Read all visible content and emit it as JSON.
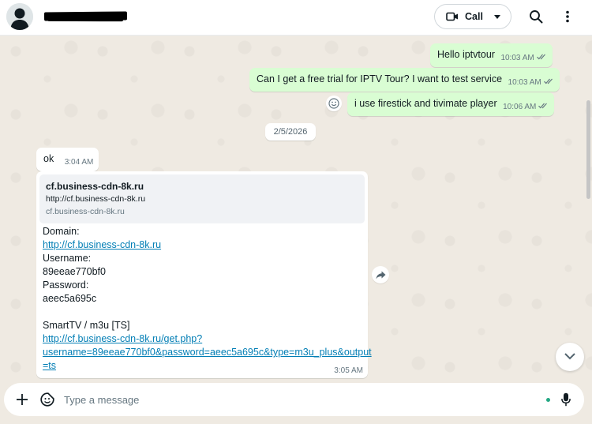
{
  "header": {
    "call_label": "Call"
  },
  "messages": [
    {
      "text": "Hello iptvtour",
      "time": "10:03 AM",
      "dir": "out"
    },
    {
      "text": "Can I get a free trial for IPTV Tour? I want to test service",
      "time": "10:03 AM",
      "dir": "out"
    },
    {
      "text": "i use firestick and tivimate player",
      "time": "10:06 AM",
      "dir": "out"
    }
  ],
  "date_separator": "2/5/2026",
  "incoming_ok": {
    "text": "ok",
    "time": "3:04 AM"
  },
  "incoming_details": {
    "preview_title": "cf.business-cdn-8k.ru",
    "preview_url": "http://cf.business-cdn-8k.ru",
    "preview_domain": "cf.business-cdn-8k.ru",
    "domain_label": "Domain:",
    "domain_link": "http://cf.business-cdn-8k.ru",
    "username_label": "Username:",
    "username": "89eeae770bf0",
    "password_label": "Password:",
    "password": "aeec5a695c",
    "m3u_label": "SmartTV / m3u [TS]",
    "m3u_link_line1": "http://cf.business-cdn-8k.ru/get.php?",
    "m3u_link_line2": "username=89eeae770bf0&password=aeec5a695c&type=m3u_plus&output",
    "m3u_link_line3": "=ts",
    "time": "3:05 AM"
  },
  "composer": {
    "placeholder": "Type a message"
  },
  "colors": {
    "outgoing_bubble": "#d9fdd3",
    "incoming_bubble": "#ffffff",
    "chat_bg": "#efeae2",
    "link": "#027eb5",
    "accent": "#25a884"
  },
  "icons": [
    "avatar-icon",
    "video-camera-icon",
    "chevron-down-icon",
    "search-icon",
    "more-vertical-icon",
    "emoji-react-icon",
    "forward-icon",
    "chevron-down-icon",
    "plus-icon",
    "sticker-icon",
    "microphone-icon",
    "double-check-icon"
  ]
}
